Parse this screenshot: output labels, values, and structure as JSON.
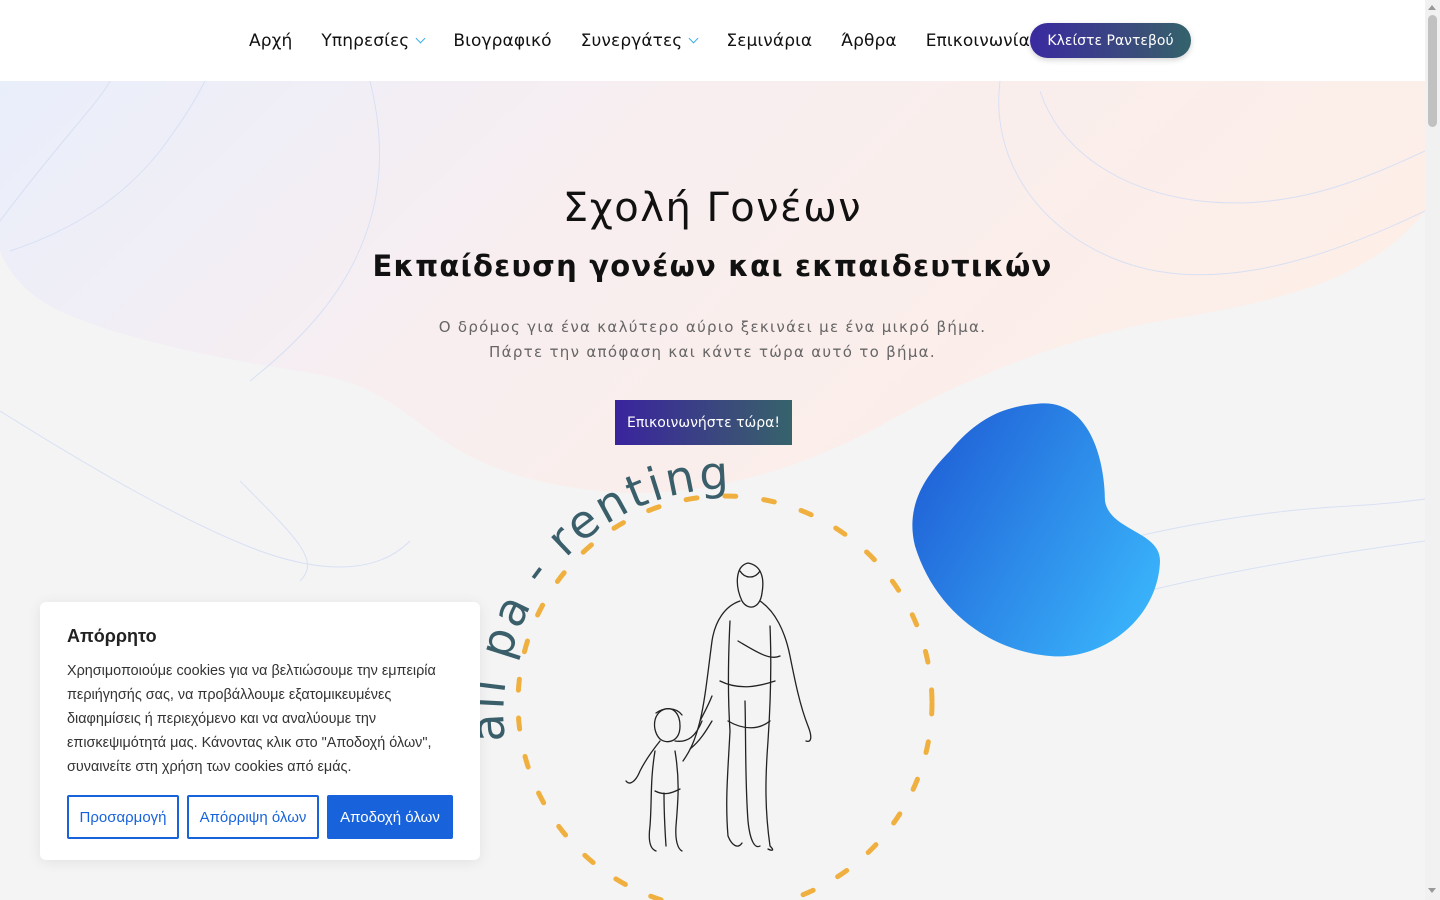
{
  "nav": {
    "items": [
      {
        "label": "Αρχή",
        "has_dropdown": false
      },
      {
        "label": "Υπηρεσίες",
        "has_dropdown": true
      },
      {
        "label": "Βιογραφικό",
        "has_dropdown": false
      },
      {
        "label": "Συνεργάτες",
        "has_dropdown": true
      },
      {
        "label": "Σεμινάρια",
        "has_dropdown": false
      },
      {
        "label": "Άρθρα",
        "has_dropdown": false
      },
      {
        "label": "Επικοινωνία",
        "has_dropdown": false
      }
    ],
    "cta_label": "Κλείστε Ραντεβού",
    "dropdown_icon": "chevron-down-icon"
  },
  "hero": {
    "title": "Σχολή Γονέων",
    "subtitle": "Εκπαίδευση γονέων και εκπαιδευτικών",
    "text_line1": "Ο δρόμος για ένα καλύτερο αύριο ξεκινάει με ένα μικρό βήμα.",
    "text_line2": "Πάρτε την απόφαση και κάντε τώρα αυτό το βήμα.",
    "button_label": "Επικοινωνήστε τώρα!",
    "logo_text": "all pa - renting"
  },
  "cookie": {
    "title": "Απόρρητο",
    "text": "Χρησιμοποιούμε cookies για να βελτιώσουμε την εμπειρία περιήγησής σας, να προβάλλουμε εξατομικευμένες διαφημίσεις ή περιεχόμενο και να αναλύουμε την επισκεψιμότητά μας. Κάνοντας κλικ στο \"Αποδοχή όλων\", συναινείτε στη χρήση των cookies από εμάς.",
    "customize_label": "Προσαρμογή",
    "reject_label": "Απόρριψη όλων",
    "accept_label": "Αποδοχή όλων"
  },
  "colors": {
    "accent_purple": "#3a249e",
    "accent_teal": "#36636b",
    "cookie_blue": "#1863dc",
    "dashed_ring": "#f0b040",
    "blob_blue_dark": "#1f5fd6",
    "blob_blue_light": "#3ab5fb"
  }
}
